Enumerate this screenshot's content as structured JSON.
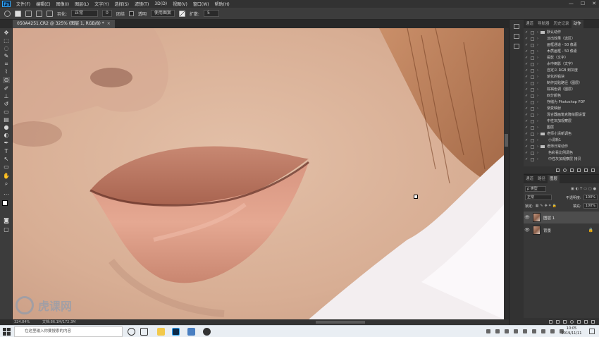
{
  "app": {
    "logo": "Ps",
    "menu": [
      "文件(F)",
      "编辑(E)",
      "图像(I)",
      "图层(L)",
      "文字(Y)",
      "选择(S)",
      "滤镜(T)",
      "3D(D)",
      "视图(V)",
      "窗口(W)",
      "帮助(H)"
    ],
    "window_controls": [
      "—",
      "☐",
      "✕"
    ]
  },
  "options_bar": {
    "feather_label": "羽化:",
    "feather_value": "0 像素",
    "mode_value": "正常",
    "opacity_icon": "0",
    "toggle_label": "团结",
    "transparent_label": "透明",
    "use_pattern_button": "使用图案",
    "spread_label": "扩散:",
    "spread_value": "5"
  },
  "document": {
    "tab_title": "050A4251.CR2 @ 325% (图层 1, RGB/8) *",
    "close": "×"
  },
  "status": {
    "zoom": "324.84%",
    "doc_info": "文档:86.1M/172.3M"
  },
  "actions_panel": {
    "tabs": [
      "通道",
      "导航器",
      "历史记录",
      "动作"
    ],
    "active_tab": "动作",
    "rows": [
      {
        "label": "默认动作",
        "type": "folder"
      },
      {
        "label": "淡出效果（选区）",
        "type": "item"
      },
      {
        "label": "画框通道 - 50 像素",
        "type": "item"
      },
      {
        "label": "木质画框 - 50 像素",
        "type": "item"
      },
      {
        "label": "投影（文字）",
        "type": "item"
      },
      {
        "label": "水中倒影（文字）",
        "type": "item"
      },
      {
        "label": "自定义 RGB 到灰度",
        "type": "item"
      },
      {
        "label": "熔化的铅块",
        "type": "item"
      },
      {
        "label": "制作剪贴路径（图层）",
        "type": "item"
      },
      {
        "label": "棕褐色调（图层）",
        "type": "item"
      },
      {
        "label": "四分颜色",
        "type": "item"
      },
      {
        "label": "存储为 Photoshop PDF",
        "type": "item"
      },
      {
        "label": "渐变映射",
        "type": "item"
      },
      {
        "label": "混合器画笔克隆绘图设置",
        "type": "item"
      },
      {
        "label": "中性灰加观察层",
        "type": "item"
      },
      {
        "label": "图层",
        "type": "item"
      },
      {
        "label": "老师小清新调色",
        "type": "folder"
      },
      {
        "label": "小清新1",
        "type": "sub"
      },
      {
        "label": "老师日常动作",
        "type": "folder"
      },
      {
        "label": "色彩看比例调色",
        "type": "sub"
      },
      {
        "label": "中性灰加观察层 拷贝",
        "type": "sub"
      }
    ]
  },
  "layers_panel": {
    "tabs": [
      "通道",
      "路径",
      "图层"
    ],
    "active_tab": "图层",
    "filter_label": "ρ 类型",
    "blend_mode": "正常",
    "opacity_label": "不透明度:",
    "opacity_value": "100%",
    "lock_label": "锁定:",
    "fill_label": "填充:",
    "fill_value": "100%",
    "layers": [
      {
        "name": "图层 1",
        "selected": true,
        "locked": false
      },
      {
        "name": "背景",
        "selected": false,
        "locked": true
      }
    ]
  },
  "taskbar": {
    "search_placeholder": "在这里输入你要搜索的内容",
    "time": "10:05",
    "date": "2019/11/11"
  },
  "watermark": "虎课网"
}
